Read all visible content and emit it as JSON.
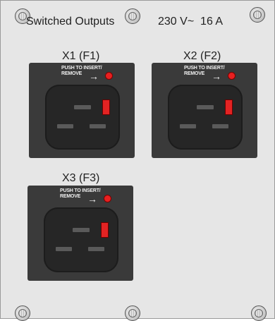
{
  "header": {
    "title": "Switched Outputs",
    "rating": "230 V~  16 A"
  },
  "outlets": [
    {
      "label": "X1 (F1)",
      "push_text": "PUSH TO INSERT/",
      "remove_text": "REMOVE",
      "arrow": "→"
    },
    {
      "label": "X2 (F2)",
      "push_text": "PUSH TO INSERT/",
      "remove_text": "REMOVE",
      "arrow": "→"
    },
    {
      "label": "X3 (F3)",
      "push_text": "PUSH TO INSERT/",
      "remove_text": "REMOVE",
      "arrow": "→"
    }
  ],
  "colors": {
    "panel": "#e6e6e6",
    "outlet_body": "#3a3a3a",
    "socket": "#262626",
    "indicator": "#e82020"
  },
  "icons": [
    "screw-icon",
    "indicator-led-icon",
    "arrow-right-icon"
  ]
}
